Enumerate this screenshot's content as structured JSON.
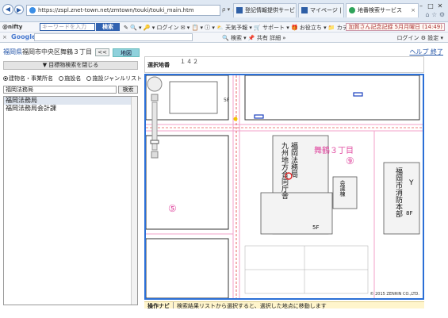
{
  "browser": {
    "url": "https://zspl.znet-town.net/zmtown/touki/touki_main.htm",
    "addr_tools": "ρ ▾ 🔒 C ✕",
    "tabs": [
      {
        "label": "登記情報提供サービス",
        "active": false
      },
      {
        "label": "マイページ | 登記情報提…",
        "active": false
      },
      {
        "label": "地番検索サービス",
        "active": true
      }
    ],
    "toolbar1": {
      "brand": "@nifty",
      "keyword_placeholder": "キーワードを入力",
      "search_label": "検索",
      "items": "✎ 🔍 ▾ 🔑 ▾ ログイン ✉ ▾ 📋 ▾ ⓘ ▾ ⛅ 天気予報 ▾ 🛒 サポート ▾ 🎁 お役立ち ▾ 📁 カテ",
      "news": "加賀さん記念記録 5月月曜日 (14:49)"
    },
    "toolbar2": {
      "google": "Google",
      "items": "🔍 検索 ▾ 📌 共有 詳細 »",
      "login": "ログイン ⚙ 設定 ▾"
    }
  },
  "page": {
    "breadcrumb_pref": "福岡県",
    "breadcrumb_rest": "福岡市中央区舞鶴３丁目",
    "collapse_label": "<<",
    "map_tab_label": "地図",
    "help_label": "ヘルプ",
    "close_label": "終了",
    "panel_header": "▼ 目標物検索を閉じる",
    "radios": [
      {
        "label": "建物名・事業所名",
        "checked": true
      },
      {
        "label": "施設名",
        "checked": false
      },
      {
        "label": "施設ジャンルリスト",
        "checked": false
      }
    ],
    "search_value": "福岡法務局",
    "search_button": "検索",
    "results": [
      {
        "label": "福岡法務局",
        "selected": true
      },
      {
        "label": "福岡法務局会計課",
        "selected": false
      }
    ],
    "map_addr_label": "選択地番",
    "map_addr_value": "１４２",
    "map_labels": {
      "district": "舞鶴３丁目",
      "block9": "⑨",
      "block5": "⑤",
      "bldg1": "福岡法務局",
      "bldg2": "九州地方合同庁舎",
      "bldg3": "福岡市消防本部",
      "bldg4": "会議棟",
      "fire": "Y",
      "floors_5f": "5F",
      "floors_8f": "8F"
    },
    "copyright": "© 2015 ZENRIN CO.,LTD.",
    "op_navi_label": "操作ナビ",
    "op_navi_text": "検索結果リストから選択すると、選択した地点に移動します"
  }
}
